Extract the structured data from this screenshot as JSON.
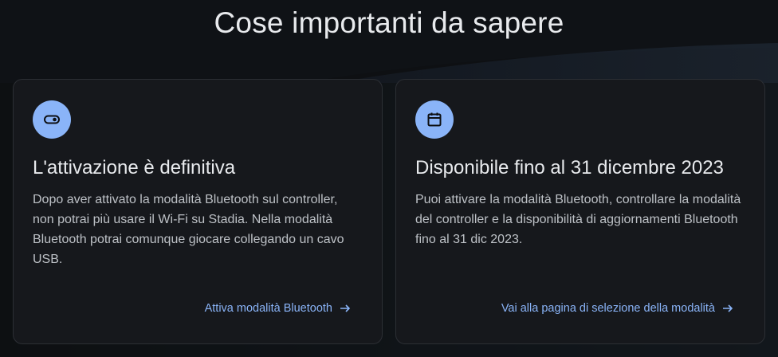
{
  "page": {
    "title": "Cose importanti da sapere"
  },
  "cards": [
    {
      "icon": "toggle-icon",
      "heading": "L'attivazione è definitiva",
      "body": "Dopo aver attivato la modalità Bluetooth sul controller, non potrai più usare il Wi-Fi su Stadia. Nella modalità Bluetooth potrai comunque giocare collegando un cavo USB.",
      "link": "Attiva modalità Bluetooth"
    },
    {
      "icon": "calendar-icon",
      "heading": "Disponibile fino al 31 dicembre 2023",
      "body": "Puoi attivare la modalità Bluetooth, controllare la modalità del controller e la disponibilità di aggiornamenti Bluetooth fino al 31 dic 2023.",
      "link": "Vai alla pagina di selezione della modalità"
    }
  ],
  "colors": {
    "accent": "#8ab4f8",
    "background": "#0e1013",
    "card": "#16181c"
  }
}
